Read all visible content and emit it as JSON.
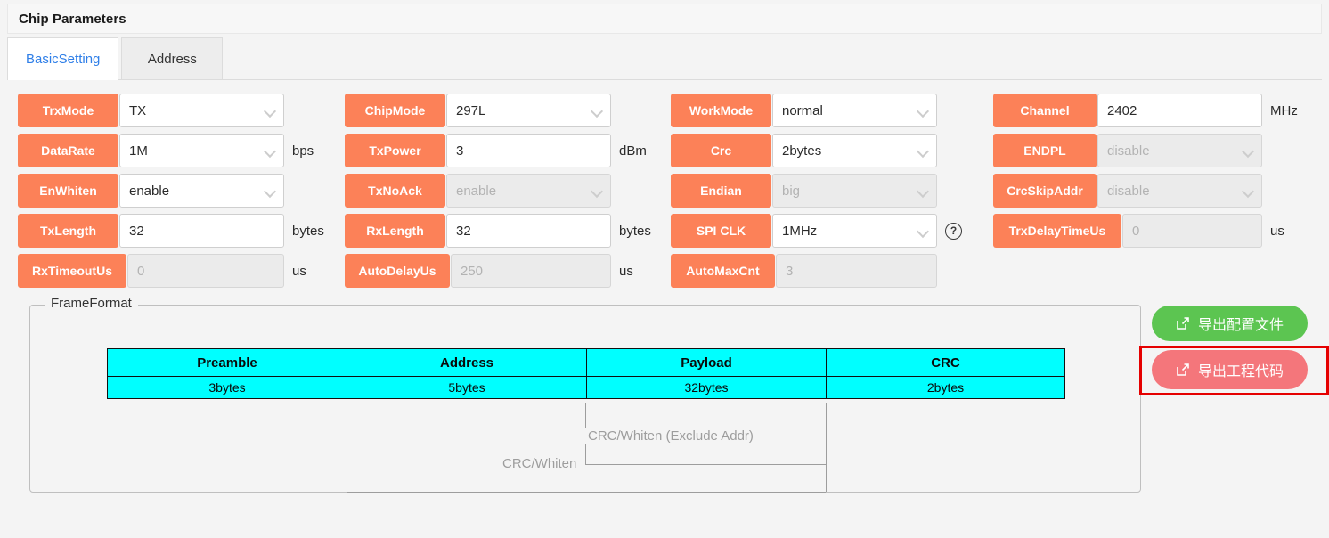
{
  "panel": {
    "title": "Chip Parameters"
  },
  "tabs": [
    {
      "label": "BasicSetting",
      "active": true
    },
    {
      "label": "Address",
      "active": false
    }
  ],
  "fields": [
    {
      "label": "TrxMode",
      "value": "TX",
      "unit": "",
      "type": "select",
      "disabled": false
    },
    {
      "label": "DataRate",
      "value": "1M",
      "unit": "bps",
      "type": "select",
      "disabled": false
    },
    {
      "label": "EnWhiten",
      "value": "enable",
      "unit": "",
      "type": "select",
      "disabled": false
    },
    {
      "label": "TxLength",
      "value": "32",
      "unit": "bytes",
      "type": "input",
      "disabled": false
    },
    {
      "label": "RxTimeoutUs",
      "value": "0",
      "unit": "us",
      "type": "input",
      "disabled": true
    },
    {
      "label": "ChipMode",
      "value": "297L",
      "unit": "",
      "type": "select",
      "disabled": false
    },
    {
      "label": "TxPower",
      "value": "3",
      "unit": "dBm",
      "type": "input",
      "disabled": false
    },
    {
      "label": "TxNoAck",
      "value": "enable",
      "unit": "",
      "type": "select",
      "disabled": true
    },
    {
      "label": "RxLength",
      "value": "32",
      "unit": "bytes",
      "type": "input",
      "disabled": false
    },
    {
      "label": "AutoDelayUs",
      "value": "250",
      "unit": "us",
      "type": "input",
      "disabled": true
    },
    {
      "label": "WorkMode",
      "value": "normal",
      "unit": "",
      "type": "select",
      "disabled": false
    },
    {
      "label": "Crc",
      "value": "2bytes",
      "unit": "",
      "type": "select",
      "disabled": false
    },
    {
      "label": "Endian",
      "value": "big",
      "unit": "",
      "type": "select",
      "disabled": true
    },
    {
      "label": "SPI CLK",
      "value": "1MHz",
      "unit": "",
      "type": "select",
      "disabled": false,
      "help": "?"
    },
    {
      "label": "AutoMaxCnt",
      "value": "3",
      "unit": "",
      "type": "input",
      "disabled": true
    },
    {
      "label": "Channel",
      "value": "2402",
      "unit": "MHz",
      "type": "input",
      "disabled": false
    },
    {
      "label": "ENDPL",
      "value": "disable",
      "unit": "",
      "type": "select",
      "disabled": true
    },
    {
      "label": "CrcSkipAddr",
      "value": "disable",
      "unit": "",
      "type": "select",
      "disabled": true
    },
    {
      "label": "TrxDelayTimeUs",
      "value": "0",
      "unit": "us",
      "type": "input",
      "disabled": true
    }
  ],
  "frame_format": {
    "legend": "FrameFormat",
    "columns": [
      {
        "name": "Preamble",
        "size": "3bytes"
      },
      {
        "name": "Address",
        "size": "5bytes"
      },
      {
        "name": "Payload",
        "size": "32bytes"
      },
      {
        "name": "CRC",
        "size": "2bytes"
      }
    ],
    "brackets": [
      {
        "label": "CRC/Whiten (Exclude Addr)"
      },
      {
        "label": "CRC/Whiten"
      }
    ]
  },
  "buttons": {
    "export_config": {
      "label": "导出配置文件",
      "icon": "export-icon",
      "color": "#5cc551"
    },
    "export_code": {
      "label": "导出工程代码",
      "icon": "export-icon",
      "color": "#f4767b"
    }
  },
  "colors": {
    "label_orange": "#fc8158",
    "frame_cyan": "#00ffff",
    "tab_active_text": "#2f7fe8",
    "highlight_red": "#e50000",
    "page_bg": "#f4f4f4"
  }
}
